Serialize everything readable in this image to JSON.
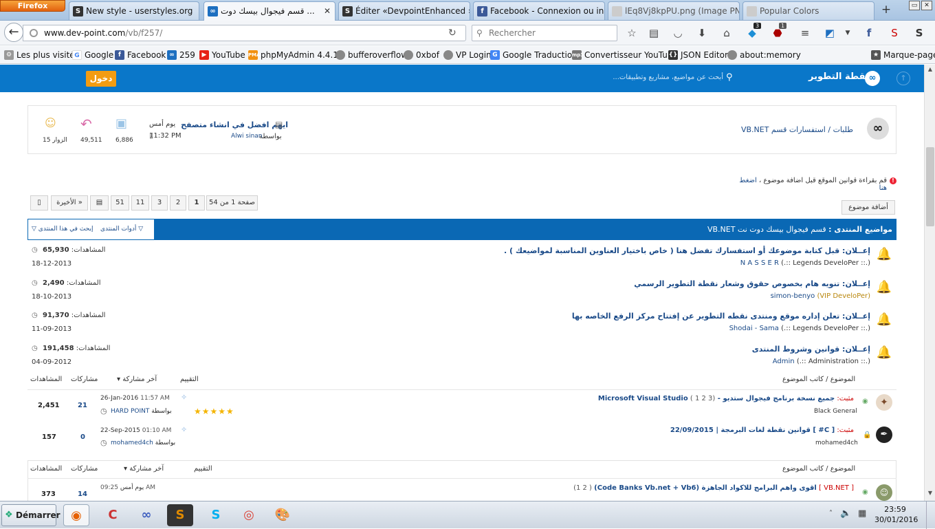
{
  "browser": {
    "menu_label": "Firefox",
    "tabs": [
      {
        "title": "New style - userstyles.org",
        "icon": "S"
      },
      {
        "title": "قسم فيجوال بيسك دوت ...",
        "icon": "∞"
      },
      {
        "title": "Éditer «DevpointEnhanced »",
        "icon": "S"
      },
      {
        "title": "Facebook - Connexion ou insc...",
        "icon": "f"
      },
      {
        "title": "lEq8Vj8kpPU.png (Image PNG...",
        "icon": ""
      },
      {
        "title": "Popular Colors",
        "icon": ""
      }
    ],
    "url_host": "www.dev-point.com",
    "url_path": "/vb/f257/",
    "search_placeholder": "Rechercher",
    "badges": {
      "pocket": "3",
      "ublock": "1"
    },
    "bookmarks": [
      {
        "label": "Les plus visités",
        "icon": "gear-icon"
      },
      {
        "label": "Google",
        "icon": "google-icon"
      },
      {
        "label": "Facebook",
        "icon": "facebook-icon"
      },
      {
        "label": "259",
        "icon": "devpoint-icon"
      },
      {
        "label": "YouTube",
        "icon": "youtube-icon"
      },
      {
        "label": "phpMyAdmin 4.4.14",
        "icon": "pma-icon"
      },
      {
        "label": "bufferoverflow",
        "icon": "globe-icon"
      },
      {
        "label": "0xbof",
        "icon": "globe-icon"
      },
      {
        "label": "VP Login",
        "icon": "globe-icon"
      },
      {
        "label": "Google Traduction",
        "icon": "translate-icon"
      },
      {
        "label": "Convertisseur YouTu...",
        "icon": "mp3-icon"
      },
      {
        "label": "JSON Editor",
        "icon": "json-icon"
      },
      {
        "label": "about:memory",
        "icon": "globe-icon"
      }
    ],
    "bookmarks_menu": "Marque-pages"
  },
  "site": {
    "login_label": "دخول",
    "search_placeholder": "أبحث عن مواضيع، مشاريع وتطبيقات...",
    "logo_text": "نقطة التطوير"
  },
  "subforum": {
    "title": "طلبات / استفسارات قسم VB.NET",
    "last_post_title": "ايهم افضل في انشاء متصفح",
    "last_post_time_label": "يوم أمس",
    "last_post_time": "11:32 PM",
    "last_post_by_label": "بواسطة",
    "last_post_author": "Alwi sinan",
    "topics_count": "6,886",
    "posts_count": "49,511",
    "visitors": "الزوار 15"
  },
  "notice": {
    "text": "قم بقراءة قوانين الموقع قبل اضافة موضوع ،",
    "link": "اضغط هنا"
  },
  "pagination": {
    "add_topic": "أضافة موضوع",
    "page_info": "صفحة 1 من 54",
    "pages": [
      "1",
      "2",
      "3",
      "11",
      "51"
    ],
    "last": "الأخيرة »"
  },
  "forum_header": {
    "title_prefix": "مواضيع المنتدى :",
    "title": "قسم فيجوال بيسك دوت نت VB.NET",
    "tools": "أدوات المنتدى",
    "search": "إبحث في هذا المنتدى"
  },
  "announcements": [
    {
      "prefix": "إعــلان:",
      "title": "قبل كتابة موضوعك أو استفسارك تفضل هنا ( خاص باختيار العناوين المناسبة لمواضيعك ) .",
      "author": "N A S S E R",
      "rank": "(.:: Legends DeveloPer ::.)",
      "views_label": "المشاهدات:",
      "views": "65,930",
      "date": "18-12-2013"
    },
    {
      "prefix": "إعــلان:",
      "title": "تنويه هام بخصوص حقوق وشعار نقطة التطوير الرسمي",
      "author": "simon-benyo",
      "rank": "(VIP DeveloPer)",
      "views_label": "المشاهدات:",
      "views": "2,490",
      "date": "18-10-2013"
    },
    {
      "prefix": "إعــلان:",
      "title": "تعلن إداره موقع ومنتدى نقطه التطوير عن إفتتاح مركز الرفع الخاصه بها",
      "author": "Shodai - Sama",
      "rank": "(.:: Legends DeveloPer ::.)",
      "views_label": "المشاهدات:",
      "views": "91,370",
      "date": "11-09-2013"
    },
    {
      "prefix": "إعــلان:",
      "title": "قوانين وشروط المنتدى",
      "author": "Admin",
      "rank": "(.:: Administration ::.)",
      "views_label": "المشاهدات:",
      "views": "191,458",
      "date": "04-09-2012"
    }
  ],
  "columns": {
    "topic": "الموضوع / كاتب الموضوع",
    "rating": "التقييم",
    "last_post": "آخر مشاركة",
    "replies": "مشاركات",
    "views": "المشاهدات"
  },
  "sticky": [
    {
      "prefix": "مثبت:",
      "title": "جميع نسخة برنامج فيجوال ستديو - Microsoft Visual Studio",
      "pages": "( 1 2 3)",
      "author": "Black General",
      "date": "26-Jan-2016",
      "time": "11:57 AM",
      "by_label": "بواسطة",
      "last_author": "HARD POINT",
      "replies": "21",
      "views": "2,451",
      "rating": 5
    },
    {
      "prefix": "مثبت:",
      "title": "[ C# ] قوانين نقطة لغات البرمجة | 22/09/2015",
      "pages": "",
      "author": "mohamed4ch",
      "date": "22-Sep-2015",
      "time": "01:10 AM",
      "by_label": "بواسطة",
      "last_author": "mohamed4ch",
      "replies": "0",
      "views": "157",
      "rating": 0
    }
  ],
  "normal": [
    {
      "prefix": "[ VB.NET ]",
      "title": "اقوى واهم البرامج للاكواد الجاهزة (Code Banks Vb.net + Vb6)",
      "pages": "( 1 2)",
      "date_label": "يوم أمس",
      "time": "09:25 AM",
      "replies": "14",
      "views": "373"
    }
  ],
  "taskbar": {
    "start": "Démarrer",
    "time": "23:59",
    "date": "30/01/2016"
  }
}
